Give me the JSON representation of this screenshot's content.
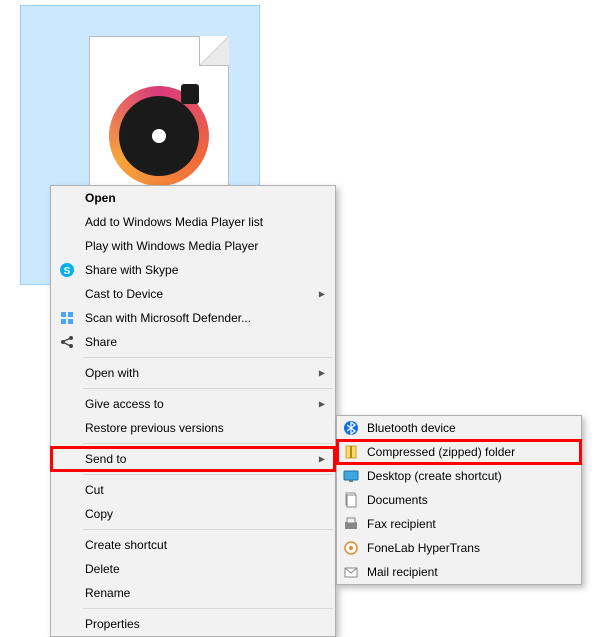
{
  "file": {
    "icon_name": "music-file-icon"
  },
  "main_menu": [
    {
      "label": "Open",
      "bold": true
    },
    {
      "label": "Add to Windows Media Player list"
    },
    {
      "label": "Play with Windows Media Player"
    },
    {
      "label": "Share with Skype",
      "icon": "skype"
    },
    {
      "label": "Cast to Device",
      "submenu": true
    },
    {
      "label": "Scan with Microsoft Defender...",
      "icon": "defender"
    },
    {
      "label": "Share",
      "icon": "share"
    },
    {
      "sep": true
    },
    {
      "label": "Open with",
      "submenu": true
    },
    {
      "sep": true
    },
    {
      "label": "Give access to",
      "submenu": true
    },
    {
      "label": "Restore previous versions"
    },
    {
      "sep": true
    },
    {
      "label": "Send to",
      "submenu": true,
      "highlight": true
    },
    {
      "sep": true
    },
    {
      "label": "Cut"
    },
    {
      "label": "Copy"
    },
    {
      "sep": true
    },
    {
      "label": "Create shortcut"
    },
    {
      "label": "Delete"
    },
    {
      "label": "Rename"
    },
    {
      "sep": true
    },
    {
      "label": "Properties"
    }
  ],
  "sub_menu": [
    {
      "label": "Bluetooth device",
      "icon": "bluetooth"
    },
    {
      "label": "Compressed (zipped) folder",
      "icon": "zip",
      "highlight": true
    },
    {
      "label": "Desktop (create shortcut)",
      "icon": "desktop"
    },
    {
      "label": "Documents",
      "icon": "documents"
    },
    {
      "label": "Fax recipient",
      "icon": "fax"
    },
    {
      "label": "FoneLab HyperTrans",
      "icon": "hypertrans"
    },
    {
      "label": "Mail recipient",
      "icon": "mail"
    }
  ]
}
